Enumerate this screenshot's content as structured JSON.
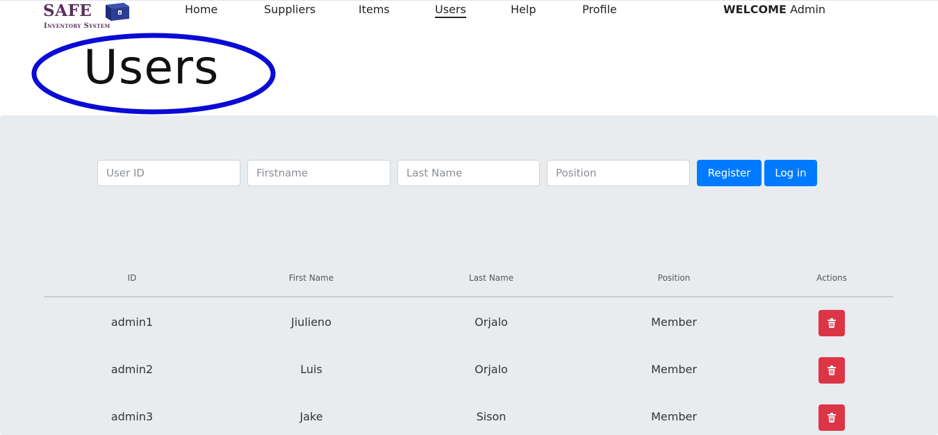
{
  "brand": {
    "name": "SAFE",
    "subtitle": "Inventory System",
    "colors": {
      "primary": "#5a2f5e",
      "box": "#2c3e94"
    }
  },
  "nav": {
    "items": [
      {
        "label": "Home",
        "active": false
      },
      {
        "label": "Suppliers",
        "active": false
      },
      {
        "label": "Items",
        "active": false
      },
      {
        "label": "Users",
        "active": true
      },
      {
        "label": "Help",
        "active": false
      },
      {
        "label": "Profile",
        "active": false
      }
    ],
    "welcome_prefix": "WELCOME",
    "welcome_user": "Admin"
  },
  "page": {
    "title": "Users",
    "annotation_color": "#0a0ad6"
  },
  "form": {
    "user_id_placeholder": "User ID",
    "firstname_placeholder": "Firstname",
    "lastname_placeholder": "Last Name",
    "position_placeholder": "Position",
    "register_label": "Register",
    "login_label": "Log in",
    "button_color": "#007bff"
  },
  "table": {
    "headers": [
      "ID",
      "First Name",
      "Last Name",
      "Position",
      "Actions"
    ],
    "rows": [
      {
        "id": "admin1",
        "first": "Jiulieno",
        "last": "Orjalo",
        "position": "Member"
      },
      {
        "id": "admin2",
        "first": "Luis",
        "last": "Orjalo",
        "position": "Member"
      },
      {
        "id": "admin3",
        "first": "Jake",
        "last": "Sison",
        "position": "Member"
      }
    ],
    "delete_icon": "trash-icon",
    "delete_color": "#dc3545"
  }
}
